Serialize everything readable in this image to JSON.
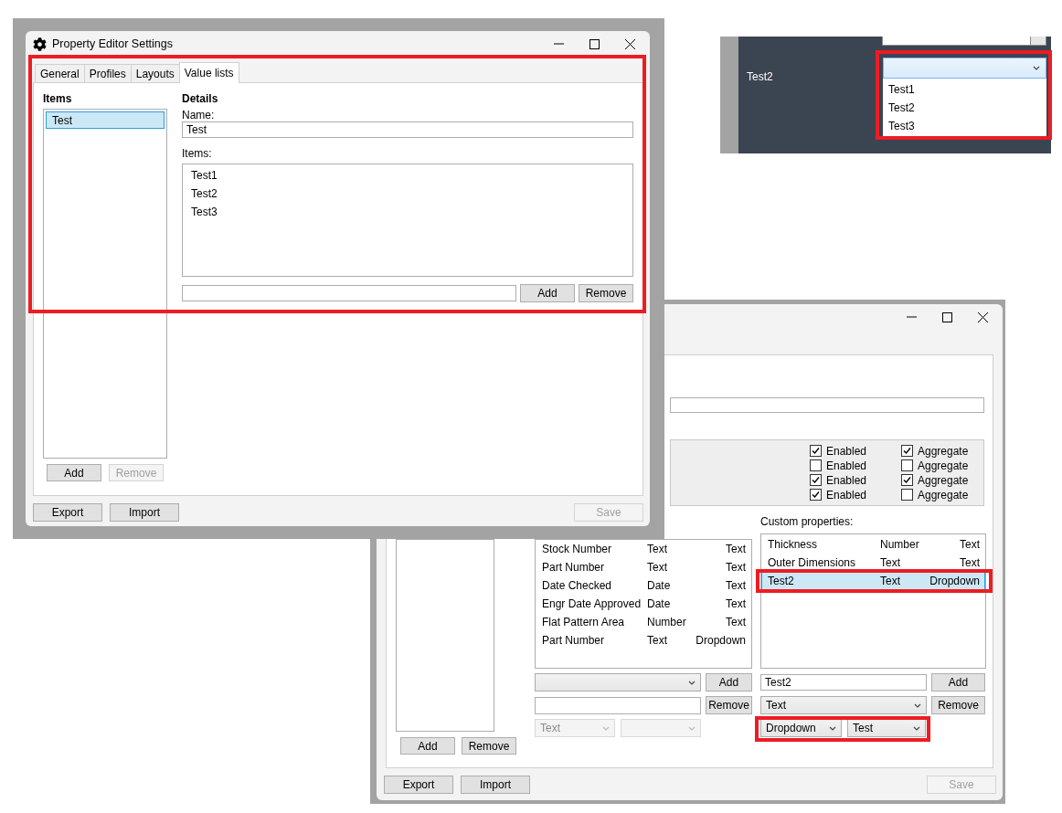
{
  "settings_window": {
    "title": "Property Editor Settings",
    "tabs": [
      {
        "label": "General",
        "selected": false
      },
      {
        "label": "Profiles",
        "selected": false
      },
      {
        "label": "Layouts",
        "selected": false
      },
      {
        "label": "Value lists",
        "selected": true
      }
    ],
    "lists_panel": {
      "heading": "Items",
      "items": [
        {
          "label": "Test",
          "selected": true
        }
      ],
      "buttons": [
        {
          "label": "Add",
          "disabled": false
        },
        {
          "label": "Remove",
          "disabled": true
        }
      ]
    },
    "details": {
      "heading": "Details",
      "name_label": "Name:",
      "name_value": "Test",
      "items_label": "Items:",
      "items": [
        "Test1",
        "Test2",
        "Test3"
      ],
      "buttons": [
        {
          "label": "Add",
          "disabled": false
        },
        {
          "label": "Remove",
          "disabled": false
        }
      ]
    },
    "footer_buttons": [
      {
        "label": "Export",
        "disabled": false
      },
      {
        "label": "Import",
        "disabled": false
      },
      {
        "label": "Save",
        "disabled": true
      }
    ]
  },
  "dropdown_preview": {
    "row_label": "Test2",
    "options": [
      "Test1",
      "Test2",
      "Test3"
    ]
  },
  "layout_window": {
    "options": [
      {
        "enabled_label": "Enabled",
        "enabled": true,
        "aggregate_label": "Aggregate",
        "aggregate": true
      },
      {
        "enabled_label": "Enabled",
        "enabled": false,
        "aggregate_label": "Aggregate",
        "aggregate": false
      },
      {
        "enabled_label": "Enabled",
        "enabled": true,
        "aggregate_label": "Aggregate",
        "aggregate": true
      },
      {
        "enabled_label": "Enabled",
        "enabled": true,
        "aggregate_label": "Aggregate",
        "aggregate": false
      }
    ],
    "profile_buttons": [
      {
        "label": "Add",
        "disabled": false
      },
      {
        "label": "Remove",
        "disabled": false
      }
    ],
    "standard_properties": [
      {
        "name": "Stock Number",
        "type": "Text",
        "control": "Text"
      },
      {
        "name": "Part Number",
        "type": "Text",
        "control": "Text"
      },
      {
        "name": "Date Checked",
        "type": "Date",
        "control": "Text"
      },
      {
        "name": "Engr Date Approved",
        "type": "Date",
        "control": "Text"
      },
      {
        "name": "Flat Pattern Area",
        "type": "Number",
        "control": "Text"
      },
      {
        "name": "Part Number",
        "type": "Text",
        "control": "Dropdown"
      }
    ],
    "standard_add": "Add",
    "standard_remove": "Remove",
    "standard_type": "Text",
    "custom_label": "Custom properties:",
    "custom_properties": [
      {
        "name": "Thickness",
        "type": "Number",
        "control": "Text",
        "selected": false
      },
      {
        "name": "Outer Dimensions",
        "type": "Text",
        "control": "Text",
        "selected": false
      },
      {
        "name": "Test2",
        "type": "Text",
        "control": "Dropdown",
        "selected": true
      }
    ],
    "custom_name": "Test2",
    "custom_add": "Add",
    "custom_type": "Text",
    "custom_remove": "Remove",
    "custom_control": "Dropdown",
    "custom_list": "Test",
    "footer_buttons": [
      {
        "label": "Export",
        "disabled": false
      },
      {
        "label": "Import",
        "disabled": false
      },
      {
        "label": "Save",
        "disabled": true
      }
    ]
  }
}
